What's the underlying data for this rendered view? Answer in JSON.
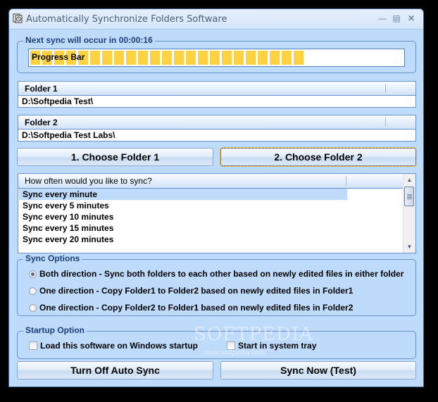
{
  "window": {
    "title": "Automatically Synchronize Folders Software",
    "icon": "sync-folder-icon",
    "controls": {
      "minimize": "minimize-icon",
      "maximize": "maximize-icon",
      "close": "close-icon"
    }
  },
  "countdown": {
    "label": "Next sync will occur in 00:00:16",
    "progress_text": "Progress Bar",
    "progress_fraction": 0.73,
    "progress_color": "#fed243"
  },
  "folders": [
    {
      "header": "Folder 1",
      "path": "D:\\Softpedia Test\\"
    },
    {
      "header": "Folder 2",
      "path": "D:\\Softpedia Test Labs\\"
    }
  ],
  "buttons": {
    "choose_folder_1": "1. Choose Folder 1",
    "choose_folder_2": "2. Choose Folder 2",
    "turn_off": "Turn Off Auto Sync",
    "sync_now": "Sync Now (Test)"
  },
  "frequency": {
    "header": "How often would you like to sync?",
    "items": [
      {
        "label": "Sync every minute",
        "selected": true
      },
      {
        "label": "Sync every 5 minutes",
        "selected": false
      },
      {
        "label": "Sync every 10 minutes",
        "selected": false
      },
      {
        "label": "Sync every 15 minutes",
        "selected": false
      },
      {
        "label": "Sync every 20 minutes",
        "selected": false
      }
    ]
  },
  "sync_options": {
    "label": "Sync Options",
    "options": [
      {
        "label": "Both direction - Sync both folders to each other based on newly edited files in either folder",
        "checked": true
      },
      {
        "label": "One direction - Copy Folder1 to Folder2 based on newly edited files in Folder1",
        "checked": false
      },
      {
        "label": "One direction - Copy Folder2 to Folder1 based on newly edited files in Folder2",
        "checked": false
      }
    ]
  },
  "startup": {
    "label": "Startup Option",
    "load_on_startup": {
      "label": "Load this software on Windows startup",
      "checked": false
    },
    "start_in_tray": {
      "label": "Start in system tray",
      "checked": false
    }
  },
  "watermark": {
    "text": "SOFTPEDIA",
    "url_text": "www.softpedia.com"
  }
}
